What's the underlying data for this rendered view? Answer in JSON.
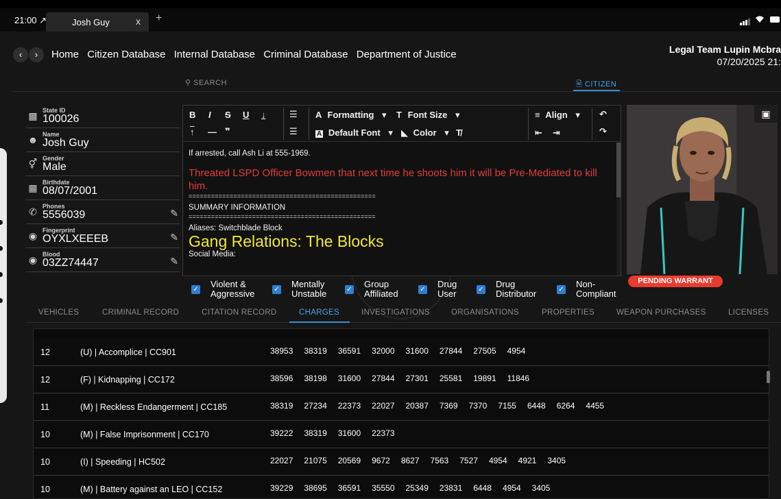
{
  "statusbar": {
    "time": "21:00 ↗",
    "tab_title": "Josh Guy",
    "tab_close": "x",
    "tab_add": "+"
  },
  "nav": {
    "links": [
      "Home",
      "Citizen Database",
      "Internal Database",
      "Criminal Database",
      "Department of Justice"
    ],
    "user_name": "Legal Team Lupin Mcbra",
    "date": "07/20/2025 21:"
  },
  "tabs": {
    "search": "SEARCH",
    "citizen": "CITIZEN"
  },
  "profile": {
    "state_id_label": "State ID",
    "state_id": "100026",
    "name_label": "Name",
    "name": "Josh Guy",
    "gender_label": "Gender",
    "gender": "Male",
    "birthdate_label": "Birthdate",
    "birthdate": "08/07/2001",
    "phones_label": "Phones",
    "phones": "5556039",
    "fingerprint_label": "Fingerprint",
    "fingerprint": "OYXLXEEEB",
    "blood_label": "Blood",
    "blood": "03ZZ74447"
  },
  "toolbar": {
    "formatting": "Formatting",
    "font_size": "Font Size",
    "align": "Align",
    "default_font": "Default Font",
    "color": "Color"
  },
  "notes": {
    "line1": "If arrested, call Ash Li at 555-1969.",
    "red": "Threated LSPD Officer Bowmen that next time he shoots him it will be Pre-Mediated to kill him.",
    "divider": "==================================================",
    "summary": "SUMMARY INFORMATION",
    "aliases": "Aliases: Switchblade Block",
    "gang": "Gang Relations: The Blocks",
    "social": "Social Media:"
  },
  "warrant": "PENDING WARRANT",
  "flags": [
    {
      "line1": "Violent &",
      "line2": "Aggressive"
    },
    {
      "line1": "Mentally",
      "line2": "Unstable"
    },
    {
      "line1": "Group",
      "line2": "Affiliated"
    },
    {
      "line1": "Drug",
      "line2": "User"
    },
    {
      "line1": "Drug",
      "line2": "Distributor"
    },
    {
      "line1": "Non-",
      "line2": "Compliant"
    }
  ],
  "section_tabs": [
    "VEHICLES",
    "CRIMINAL RECORD",
    "CITATION RECORD",
    "CHARGES",
    "INVESTIGATIONS",
    "ORGANISATIONS",
    "PROPERTIES",
    "WEAPON PURCHASES",
    "LICENSES"
  ],
  "active_section_tab": "CHARGES",
  "charges": [
    {
      "count": "12",
      "name": "(U) | Accomplice | CC901",
      "ids": [
        "38953",
        "38319",
        "36591",
        "32000",
        "31600",
        "27844",
        "27505",
        "4954"
      ]
    },
    {
      "count": "12",
      "name": "(F) | Kidnapping | CC172",
      "ids": [
        "38596",
        "38198",
        "31600",
        "27844",
        "27301",
        "25581",
        "19891",
        "11846"
      ]
    },
    {
      "count": "11",
      "name": "(M) | Reckless Endangerment | CC185",
      "ids": [
        "38319",
        "27234",
        "22373",
        "22027",
        "20387",
        "7369",
        "7370",
        "7155",
        "6448",
        "6264",
        "4455"
      ]
    },
    {
      "count": "10",
      "name": "(M) | False Imprisonment | CC170",
      "ids": [
        "39222",
        "38319",
        "31600",
        "22373"
      ]
    },
    {
      "count": "10",
      "name": "(I) | Speeding | HC502",
      "ids": [
        "22027",
        "21075",
        "20569",
        "9672",
        "8627",
        "7563",
        "7527",
        "4954",
        "4921",
        "3405"
      ]
    },
    {
      "count": "10",
      "name": "(M) | Battery against an LEO | CC152",
      "ids": [
        "39229",
        "38695",
        "36591",
        "35550",
        "25349",
        "23831",
        "6448",
        "4954",
        "3405"
      ]
    }
  ],
  "colors": {
    "accent": "#3b8fd6",
    "warrant": "#e83b2f",
    "note_red": "#e23b3b",
    "note_yellow": "#f3e92f"
  }
}
